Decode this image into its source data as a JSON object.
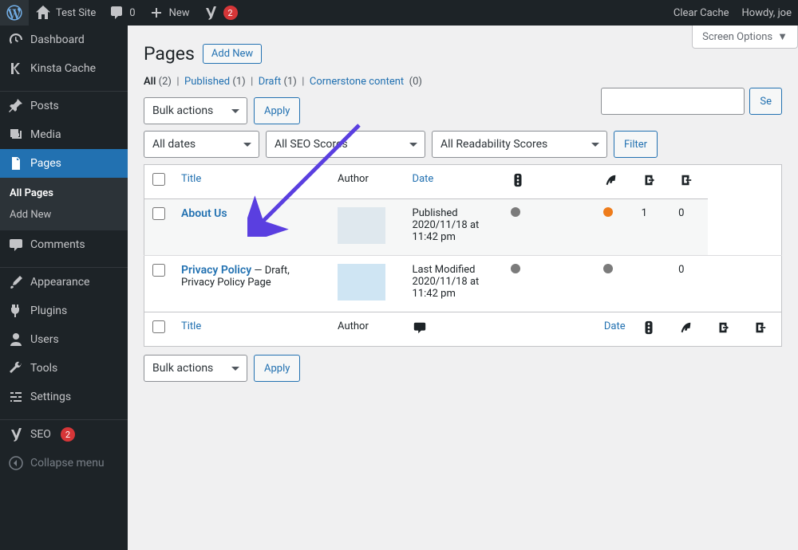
{
  "adminbar": {
    "site_name": "Test Site",
    "comments_count": "0",
    "new_label": "New",
    "yoast_badge": "2",
    "clear_cache": "Clear Cache",
    "howdy": "Howdy, joe"
  },
  "sidebar": {
    "items": [
      {
        "label": "Dashboard"
      },
      {
        "label": "Kinsta Cache"
      },
      {
        "label": "Posts"
      },
      {
        "label": "Media"
      },
      {
        "label": "Pages"
      },
      {
        "label": "Comments"
      },
      {
        "label": "Appearance"
      },
      {
        "label": "Plugins"
      },
      {
        "label": "Users"
      },
      {
        "label": "Tools"
      },
      {
        "label": "Settings"
      },
      {
        "label": "SEO",
        "badge": "2"
      },
      {
        "label": "Collapse menu"
      }
    ],
    "submenu": {
      "all_pages": "All Pages",
      "add_new": "Add New"
    }
  },
  "content": {
    "screen_options": "Screen Options",
    "page_title": "Pages",
    "add_new": "Add New",
    "filters": {
      "all": "All",
      "all_count": "(2)",
      "published": "Published",
      "published_count": "(1)",
      "draft": "Draft",
      "draft_count": "(1)",
      "cornerstone": "Cornerstone content",
      "cornerstone_count": "(0)"
    },
    "bulk_actions": "Bulk actions",
    "apply": "Apply",
    "all_dates": "All dates",
    "all_seo": "All SEO Scores",
    "all_readability": "All Readability Scores",
    "filter_btn": "Filter",
    "search_btn": "Se",
    "columns": {
      "title": "Title",
      "author": "Author",
      "date": "Date"
    },
    "rows": [
      {
        "title": "About Us",
        "state": "",
        "date_line1": "Published",
        "date_line2": "2020/11/18 at",
        "date_line3": "11:42 pm",
        "links_in": "1",
        "links_out": "0"
      },
      {
        "title": "Privacy Policy",
        "state": " — Draft, Privacy Policy Page",
        "date_line1": "Last Modified",
        "date_line2": "2020/11/18 at",
        "date_line3": "11:42 pm",
        "links_in": "",
        "links_out": "0"
      }
    ]
  }
}
